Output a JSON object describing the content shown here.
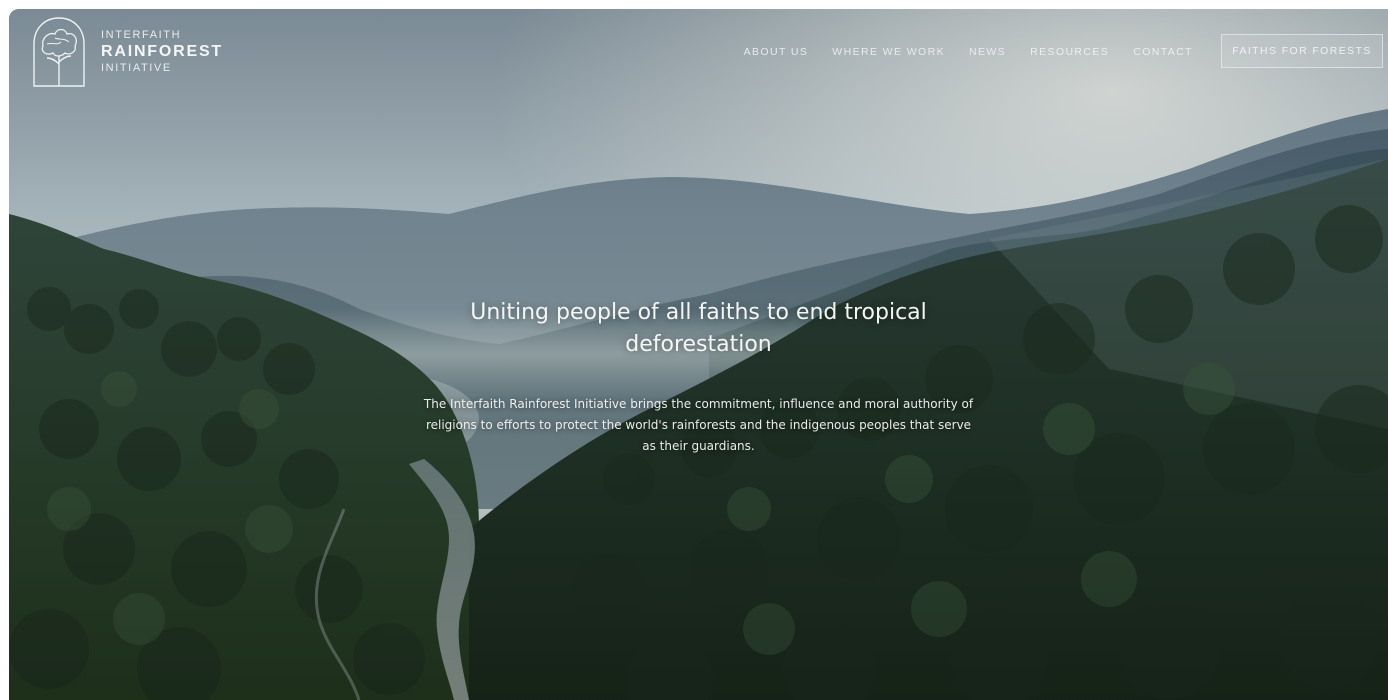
{
  "brand": {
    "line1": "INTERFAITH",
    "line2": "RAINFOREST",
    "line3": "INITIATIVE",
    "logo_icon": "tree-arch-icon"
  },
  "nav": {
    "about": "ABOUT US",
    "where": "WHERE WE WORK",
    "news": "NEWS",
    "resources": "RESOURCES",
    "contact": "CONTACT",
    "cta": "FAITHS FOR FORESTS"
  },
  "hero": {
    "title": "Uniting people of all faiths to end tropical deforestation",
    "description": "The Interfaith Rainforest Initiative brings the commitment, influence and moral authority of religions to efforts to protect the world's rainforests and the indigenous peoples that serve as their guardians."
  },
  "colors": {
    "text": "#f4f6f4",
    "sky": "#c9d4d8",
    "forest": "#1f2f1c"
  }
}
